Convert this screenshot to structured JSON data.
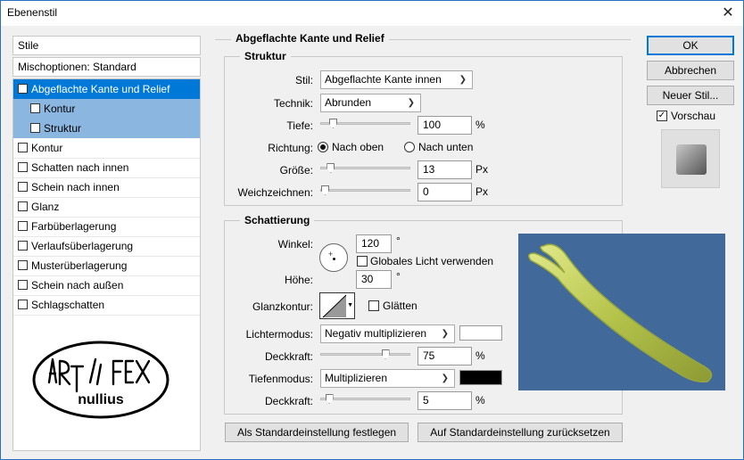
{
  "window": {
    "title": "Ebenenstil",
    "close_icon": "close-icon"
  },
  "left": {
    "stile_label": "Stile",
    "blend_options": "Mischoptionen: Standard",
    "items": [
      {
        "label": "Abgeflachte Kante und Relief",
        "checked": true
      },
      {
        "label": "Kontur",
        "checked": false
      },
      {
        "label": "Struktur",
        "checked": false
      },
      {
        "label": "Kontur",
        "checked": false
      },
      {
        "label": "Schatten nach innen",
        "checked": false
      },
      {
        "label": "Schein nach innen",
        "checked": false
      },
      {
        "label": "Glanz",
        "checked": false
      },
      {
        "label": "Farbüberlagerung",
        "checked": false
      },
      {
        "label": "Verlaufsüberlagerung",
        "checked": false
      },
      {
        "label": "Musterüberlagerung",
        "checked": false
      },
      {
        "label": "Schein nach außen",
        "checked": false
      },
      {
        "label": "Schlagschatten",
        "checked": false
      }
    ],
    "logo_text": "nullius"
  },
  "bevel": {
    "title": "Abgeflachte Kante und Relief",
    "struktur": {
      "title": "Struktur",
      "stil_label": "Stil:",
      "stil_value": "Abgeflachte Kante innen",
      "technik_label": "Technik:",
      "technik_value": "Abrunden",
      "tiefe_label": "Tiefe:",
      "tiefe_value": "100",
      "tiefe_unit": "%",
      "tiefe_fraction": 0.1,
      "richtung_label": "Richtung:",
      "nach_oben": "Nach oben",
      "nach_unten": "Nach unten",
      "direction": "up",
      "groesse_label": "Größe:",
      "groesse_value": "13",
      "groesse_unit": "Px",
      "groesse_fraction": 0.07,
      "weich_label": "Weichzeichnen:",
      "weich_value": "0",
      "weich_unit": "Px",
      "weich_fraction": 0.0
    },
    "schattierung": {
      "title": "Schattierung",
      "winkel_label": "Winkel:",
      "winkel_value": "120",
      "winkel_unit": "°",
      "global_light": "Globales Licht verwenden",
      "global_checked": false,
      "hoehe_label": "Höhe:",
      "hoehe_value": "30",
      "hoehe_unit": "°",
      "glanz_label": "Glanzkontur:",
      "glaetten": "Glätten",
      "glaetten_checked": false,
      "licht_label": "Lichtermodus:",
      "licht_value": "Negativ multiplizieren",
      "licht_color": "#ffffff",
      "deck1_label": "Deckkraft:",
      "deck1_value": "75",
      "deck1_unit": "%",
      "deck1_fraction": 0.75,
      "tiefen_label": "Tiefenmodus:",
      "tiefen_value": "Multiplizieren",
      "tiefen_color": "#000000",
      "deck2_label": "Deckkraft:",
      "deck2_value": "5",
      "deck2_unit": "%",
      "deck2_fraction": 0.05
    },
    "set_default": "Als Standardeinstellung festlegen",
    "reset_default": "Auf Standardeinstellung zurücksetzen",
    "preview_bg": "#41699a",
    "shape_color": "#b4c34a"
  },
  "right": {
    "ok": "OK",
    "cancel": "Abbrechen",
    "new_style": "Neuer Stil...",
    "preview": "Vorschau",
    "preview_checked": true
  }
}
